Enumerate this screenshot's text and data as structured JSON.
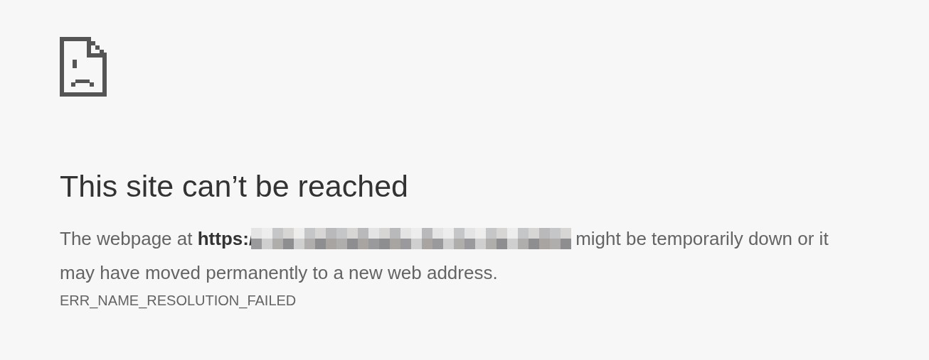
{
  "title": "This site can’t be reached",
  "message": {
    "lead": "The webpage at **https:/**",
    "tail_lines": [
      "might be temporarily down or it",
      "may have moved permanently to a new web address."
    ]
  },
  "error_code": "ERR_NAME_RESOLUTION_FAILED"
}
